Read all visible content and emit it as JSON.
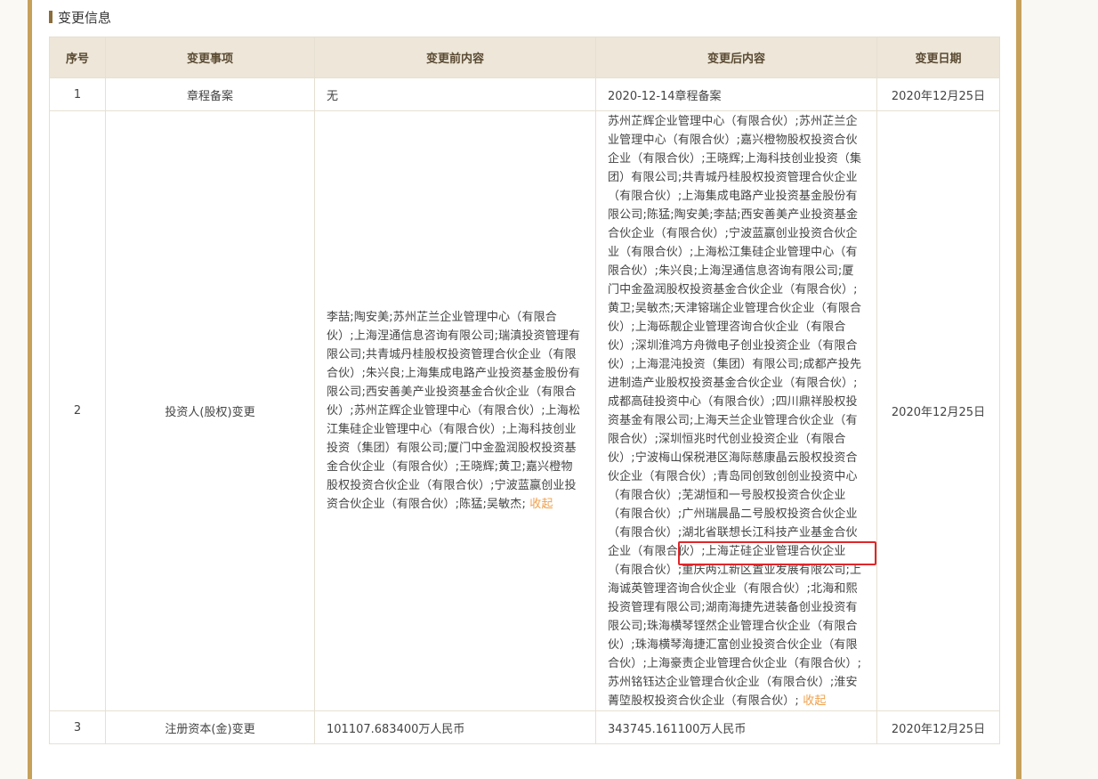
{
  "section": {
    "title": "变更信息"
  },
  "table": {
    "headers": [
      "序号",
      "变更事项",
      "变更前内容",
      "变更后内容",
      "变更日期"
    ],
    "rows": [
      {
        "no": "1",
        "item": "章程备案",
        "before": "无",
        "after": "2020-12-14章程备案",
        "date": "2020年12月25日"
      },
      {
        "no": "2",
        "item": "投资人(股权)变更",
        "before": "李喆;陶安美;苏州芷兰企业管理中心（有限合伙）;上海涅通信息咨询有限公司;瑞滇投资管理有限公司;共青城丹桂股权投资管理合伙企业（有限合伙）;朱兴良;上海集成电路产业投资基金股份有限公司;西安善美产业投资基金合伙企业（有限合伙）;苏州芷辉企业管理中心（有限合伙）;上海松江集硅企业管理中心（有限合伙）;上海科技创业投资（集团）有限公司;厦门中金盈润股权投资基金合伙企业（有限合伙）;王晓辉;黄卫;嘉兴橙物股权投资合伙企业（有限合伙）;宁波蓝嬴创业投资合伙企业（有限合伙）;陈猛;吴敏杰;",
        "after_part1": "苏州芷辉企业管理中心（有限合伙）;苏州芷兰企业管理中心（有限合伙）;嘉兴橙物股权投资合伙企业（有限合伙）;王晓辉;上海科技创业投资（集团）有限公司;共青城丹桂股权投资管理合伙企业（有限合伙）;上海集成电路产业投资基金股份有限公司;陈猛;陶安美;李喆;西安善美产业投资基金合伙企业（有限合伙）;宁波蓝嬴创业投资合伙企业（有限合伙）;上海松江集硅企业管理中心（有限合伙）;朱兴良;上海涅通信息咨询有限公司;厦门中金盈润股权投资基金合伙企业（有限合伙）;黄卫;吴敏杰;天津镕瑞企业管理合伙企业（有限合伙）;上海砾靓企业管理咨询合伙企业（有限合伙）;深圳淮鸿方舟微电子创业投资企业（有限合伙）;上海混沌投资（集团）有限公司;成都产投先进制造产业股权投资基金合伙企业（有限合伙）;成都高硅投资中心（有限合伙）;四川鼎祥股权投资基金有限公司;上海天兰企业管理合伙企业（有限合伙）;深圳恒兆时代创业投资企业（有限合伙）;宁波梅山保税港区海际慈康晶云股权投资合伙企业（有限合伙）;青岛同创致创创业投资中心（有限合伙）;芜湖恒和一号股权投资合伙企业（有限合伙）;广州瑞晨晶二号股权投资合伙企业（有限合伙）;",
        "after_highlight": "湖北省联想长江科技产业基金合",
        "after_part2": "伙企业（有限合伙）;上海芷硅企业管理合伙企业（有限合伙）;重庆两江新区置业发展有限公司;上海诚英管理咨询合伙企业（有限合伙）;北海和熙投资管理有限公司;湖南海捷先进装备创业投资有限公司;珠海横琴铿然企业管理合伙企业（有限合伙）;珠海横琴海捷汇富创业投资合伙企业（有限合伙）;上海豪责企业管理合伙企业（有限合伙）;苏州铭钰达企业管理合伙企业（有限合伙）;淮安菁埅股权投资合伙企业（有限合伙）;",
        "date": "2020年12月25日"
      },
      {
        "no": "3",
        "item": "注册资本(金)变更",
        "before": "101107.683400万人民币",
        "after": "343745.161100万人民币",
        "date": "2020年12月25日"
      }
    ],
    "collapse_label": "收起"
  }
}
